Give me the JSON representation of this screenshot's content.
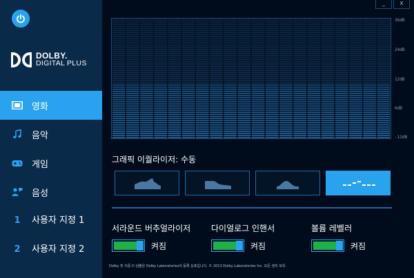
{
  "window": {
    "minimize_label": "_",
    "close_label": "x"
  },
  "brand": {
    "line1": "DOLBY.",
    "line2": "DIGITAL PLUS"
  },
  "nav": {
    "items": [
      {
        "label": "영화",
        "icon": "film-icon",
        "active": true
      },
      {
        "label": "음악",
        "icon": "music-note-icon",
        "active": false
      },
      {
        "label": "게임",
        "icon": "gamepad-icon",
        "active": false
      },
      {
        "label": "음성",
        "icon": "voice-icon",
        "active": false
      },
      {
        "label": "사용자 지정 1",
        "number": "1",
        "active": false
      },
      {
        "label": "사용자 지정 2",
        "number": "2",
        "active": false
      }
    ]
  },
  "equalizer": {
    "db_labels": [
      "36dB",
      "24dB",
      "12dB",
      "0dB",
      "-12dB"
    ],
    "title": "그래픽 이퀄라이저: 수동",
    "presets": [
      {
        "icon": "eq-preset-open-icon",
        "active": false
      },
      {
        "icon": "eq-preset-rich-icon",
        "active": false
      },
      {
        "icon": "eq-preset-focused-icon",
        "active": false
      },
      {
        "icon": "eq-preset-manual-icon",
        "active": true
      }
    ]
  },
  "features": [
    {
      "label": "서라운드 버추얼라이저",
      "state": "켜짐"
    },
    {
      "label": "다이얼로그 인핸서",
      "state": "켜짐"
    },
    {
      "label": "볼륨 레벨러",
      "state": "켜짐"
    }
  ],
  "footer": {
    "copyright": "Dolby 및 이중 D 심볼은 Dolby Laboratories의 등록 상표입니다. © 2013 Dolby Laboratories Inc. 모든 권리 보유."
  },
  "colors": {
    "accent": "#2aa3ee",
    "sidebar": "#0a2a4a",
    "background": "#000c1c",
    "toggle_on": "#1fb04a"
  }
}
